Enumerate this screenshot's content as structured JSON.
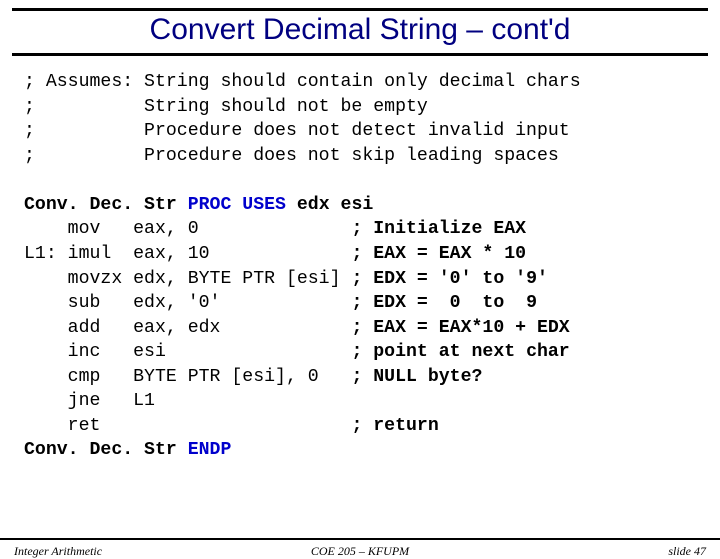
{
  "title": "Convert Decimal String – cont'd",
  "assumes": {
    "l1": "; Assumes: String should contain only decimal chars",
    "l2": ";          String should not be empty",
    "l3": ";          Procedure does not detect invalid input",
    "l4": ";          Procedure does not skip leading spaces"
  },
  "code": {
    "proc_name": "Conv. Dec. Str",
    "proc_kw": " PROC USES ",
    "proc_regs": "edx esi",
    "l1a": "    mov   eax, 0              ",
    "l1b": "; Initialize EAX",
    "l2a": "L1: imul  eax, 10             ",
    "l2b": "; EAX = EAX * 10",
    "l3a": "    movzx edx, BYTE PTR [esi] ",
    "l3b": "; EDX = '0' to '9'",
    "l4a": "    sub   edx, '0'            ",
    "l4b": "; EDX =  0  to  9",
    "l5a": "    add   eax, edx            ",
    "l5b": "; EAX = EAX*10 + EDX",
    "l6a": "    inc   esi                 ",
    "l6b": "; point at next char",
    "l7a": "    cmp   BYTE PTR [esi], 0   ",
    "l7b": "; NULL byte?",
    "l8": "    jne   L1",
    "l9a": "    ret                       ",
    "l9b": "; return",
    "endp_name": "Conv. Dec. Str",
    "endp_kw": " ENDP"
  },
  "footer": {
    "left": "Integer Arithmetic",
    "center": "COE 205 – KFUPM",
    "right": "slide 47"
  }
}
